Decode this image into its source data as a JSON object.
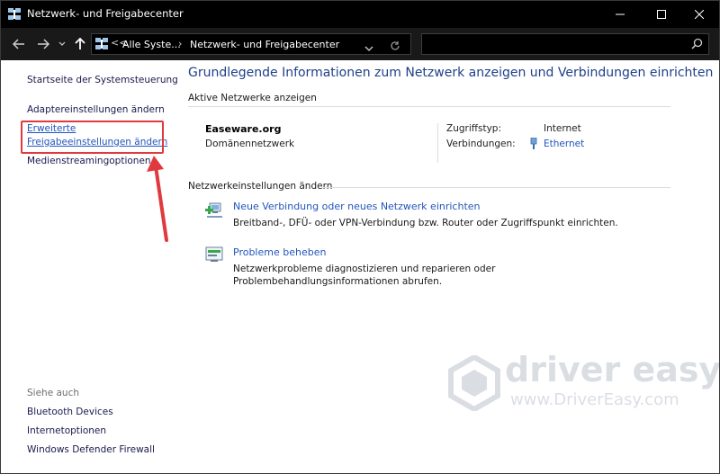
{
  "window": {
    "title": "Netzwerk- und Freigabecenter"
  },
  "address_bar": {
    "overflow": "<<",
    "crumbs": [
      "Alle Syste...",
      "Netzwerk- und Freigabecenter"
    ],
    "search_placeholder": ""
  },
  "sidebar": {
    "links": [
      "Startseite der Systemsteuerung",
      "Adaptereinstellungen ändern",
      "Erweiterte",
      "Freigabeeinstellungen ändern",
      "Medienstreamingoptionen"
    ],
    "see_also_heading": "Siehe auch",
    "see_also": [
      "Bluetooth Devices",
      "Internetoptionen",
      "Windows Defender Firewall"
    ]
  },
  "main": {
    "title": "Grundlegende Informationen zum Netzwerk anzeigen und Verbindungen einrichten",
    "active_networks_heading": "Aktive Netzwerke anzeigen",
    "network": {
      "name": "Easeware.org",
      "type": "Domänennetzwerk",
      "access_type_label": "Zugriffstyp:",
      "access_type_value": "Internet",
      "connections_label": "Verbindungen:",
      "connections_value": "Ethernet"
    },
    "change_settings_heading": "Netzwerkeinstellungen ändern",
    "tasks": [
      {
        "link": "Neue Verbindung oder neues Netzwerk einrichten",
        "desc": "Breitband-, DFÜ- oder VPN-Verbindung bzw. Router oder Zugriffspunkt einrichten."
      },
      {
        "link": "Probleme beheben",
        "desc": "Netzwerkprobleme diagnostizieren und reparieren oder Problembehandlungsinformationen abrufen."
      }
    ]
  },
  "watermark": {
    "brand": "driver easy",
    "url": "www.DriverEasy.com"
  },
  "colors": {
    "titlebar": "#000000",
    "link": "#2255bb",
    "title_blue": "#1e3f8a",
    "highlight": "#e0393e"
  }
}
